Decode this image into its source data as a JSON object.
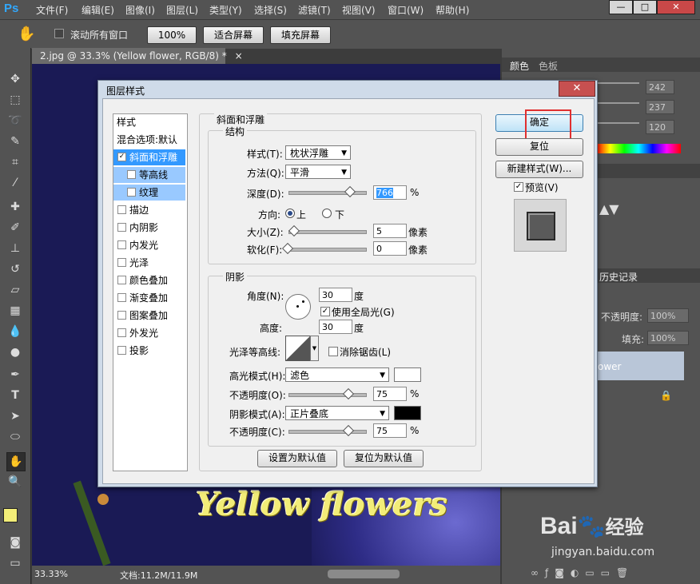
{
  "app_logo": "Ps",
  "menu": [
    "文件(F)",
    "编辑(E)",
    "图像(I)",
    "图层(L)",
    "类型(Y)",
    "选择(S)",
    "滤镜(T)",
    "视图(V)",
    "窗口(W)",
    "帮助(H)"
  ],
  "window_controls": {
    "minimize": "—",
    "restore": "□",
    "close": "✕"
  },
  "options": {
    "scroll_all_label": "滚动所有窗口",
    "zoom_100": "100%",
    "fit_screen": "适合屏幕",
    "fill_screen": "填充屏幕"
  },
  "document_tab": {
    "title": "2.jpg @ 33.3% (Yellow flower, RGB/8) *",
    "close": "×"
  },
  "canvas_text": "Yellow flowers",
  "status": {
    "zoom": "33.33%",
    "doc": "文档:11.2M/11.9M"
  },
  "panels": {
    "color_tab": "颜色",
    "swatches_tab": "色板",
    "rgb_values": [
      "242",
      "237",
      "120"
    ],
    "history_tab": "历史记录",
    "opacity_label": "不透明度:",
    "opacity_value": "100%",
    "fill_label": "填充:",
    "fill_value": "100%",
    "layer_name": "ower"
  },
  "dialog": {
    "title": "图层样式",
    "close": "✕",
    "styles_header": "样式",
    "blend_options": "混合选项:默认",
    "style_items": [
      {
        "label": "斜面和浮雕",
        "checked": true,
        "selected": true,
        "indent": false
      },
      {
        "label": "等高线",
        "checked": false,
        "selected": true,
        "indent": true
      },
      {
        "label": "纹理",
        "checked": false,
        "selected": true,
        "indent": true
      },
      {
        "label": "描边",
        "checked": false,
        "selected": false,
        "indent": false
      },
      {
        "label": "内阴影",
        "checked": false,
        "selected": false,
        "indent": false
      },
      {
        "label": "内发光",
        "checked": false,
        "selected": false,
        "indent": false
      },
      {
        "label": "光泽",
        "checked": false,
        "selected": false,
        "indent": false
      },
      {
        "label": "颜色叠加",
        "checked": false,
        "selected": false,
        "indent": false
      },
      {
        "label": "渐变叠加",
        "checked": false,
        "selected": false,
        "indent": false
      },
      {
        "label": "图案叠加",
        "checked": false,
        "selected": false,
        "indent": false
      },
      {
        "label": "外发光",
        "checked": false,
        "selected": false,
        "indent": false
      },
      {
        "label": "投影",
        "checked": false,
        "selected": false,
        "indent": false
      }
    ],
    "section_title": "斜面和浮雕",
    "structure": {
      "title": "结构",
      "style_label": "样式(T):",
      "style_value": "枕状浮雕",
      "technique_label": "方法(Q):",
      "technique_value": "平滑",
      "depth_label": "深度(D):",
      "depth_value": "766",
      "depth_unit": "%",
      "direction_label": "方向:",
      "direction_up": "上",
      "direction_down": "下",
      "size_label": "大小(Z):",
      "size_value": "5",
      "size_unit": "像素",
      "soften_label": "软化(F):",
      "soften_value": "0",
      "soften_unit": "像素"
    },
    "shading": {
      "title": "阴影",
      "angle_label": "角度(N):",
      "angle_value": "30",
      "angle_unit": "度",
      "global_light_label": "使用全局光(G)",
      "altitude_label": "高度:",
      "altitude_value": "30",
      "altitude_unit": "度",
      "gloss_contour_label": "光泽等高线:",
      "antialias_label": "消除锯齿(L)",
      "highlight_mode_label": "高光模式(H):",
      "highlight_mode_value": "滤色",
      "highlight_opacity_label": "不透明度(O):",
      "highlight_opacity_value": "75",
      "shadow_mode_label": "阴影模式(A):",
      "shadow_mode_value": "正片叠底",
      "shadow_opacity_label": "不透明度(C):",
      "shadow_opacity_value": "75",
      "percent": "%"
    },
    "make_default": "设置为默认值",
    "reset_default": "复位为默认值",
    "ok": "确定",
    "reset": "复位",
    "new_style": "新建样式(W)...",
    "preview_label": "预览(V)"
  },
  "watermark": {
    "brand": "Bai",
    "brand2": "经验",
    "url": "jingyan.baidu.com"
  },
  "colors": {
    "accent_red": "#e03030",
    "selection_blue": "#3399ff",
    "foreground": "#f2ed78"
  }
}
